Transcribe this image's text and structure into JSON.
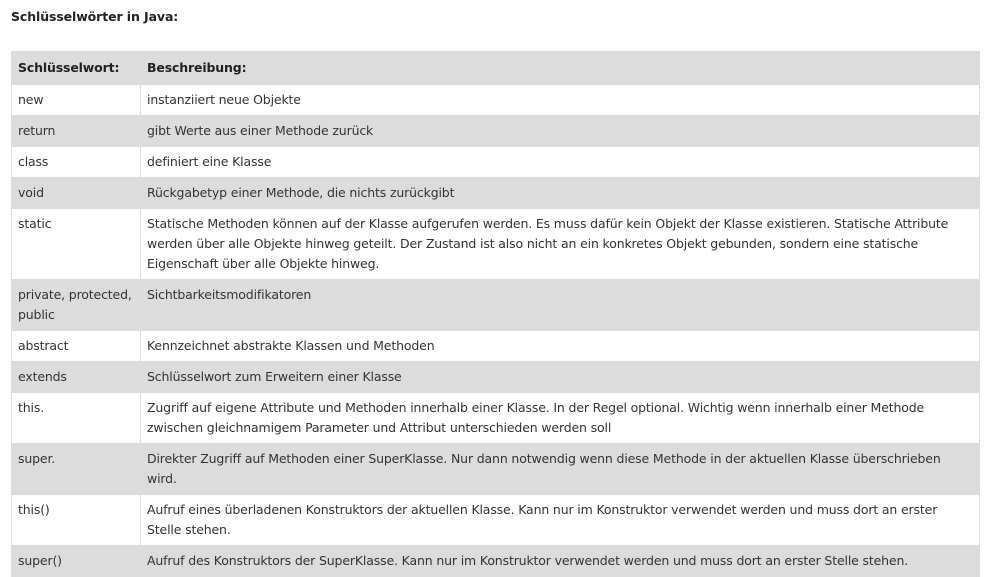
{
  "title": "Schlüsselwörter in Java:",
  "table": {
    "headers": [
      "Schlüsselwort:",
      "Beschreibung:"
    ],
    "rows": [
      {
        "keyword": "new",
        "description": "instanziiert neue Objekte"
      },
      {
        "keyword": "return",
        "description": "gibt Werte aus einer Methode zurück"
      },
      {
        "keyword": "class",
        "description": "definiert eine Klasse"
      },
      {
        "keyword": "void",
        "description": "Rückgabetyp einer Methode, die nichts zurückgibt"
      },
      {
        "keyword": "static",
        "description": "Statische Methoden können auf der Klasse aufgerufen werden. Es muss dafür kein Objekt der Klasse existieren. Statische Attribute werden über alle Objekte hinweg geteilt. Der Zustand ist also nicht an ein konkretes Objekt gebunden, sondern eine statische Eigenschaft über alle Objekte hinweg."
      },
      {
        "keyword": "private, protected, public",
        "description": "Sichtbarkeitsmodifikatoren"
      },
      {
        "keyword": "abstract",
        "description": "Kennzeichnet abstrakte Klassen und Methoden"
      },
      {
        "keyword": "extends",
        "description": "Schlüsselwort zum Erweitern einer Klasse"
      },
      {
        "keyword": "this.",
        "description": "Zugriff auf eigene Attribute und Methoden innerhalb einer Klasse. In der Regel optional. Wichtig wenn innerhalb einer Methode zwischen gleichnamigem Parameter und Attribut unterschieden werden soll"
      },
      {
        "keyword": "super.",
        "description": "Direkter Zugriff auf Methoden einer SuperKlasse. Nur dann notwendig wenn diese Methode in der aktuellen Klasse überschrieben wird."
      },
      {
        "keyword": "this()",
        "description": "Aufruf eines überladenen Konstruktors der aktuellen Klasse. Kann nur im Konstruktor verwendet werden und muss dort an erster Stelle stehen."
      },
      {
        "keyword": "super()",
        "description": "Aufruf des Konstruktors der SuperKlasse. Kann nur im Konstruktor verwendet werden und muss dort an erster Stelle stehen."
      }
    ]
  }
}
